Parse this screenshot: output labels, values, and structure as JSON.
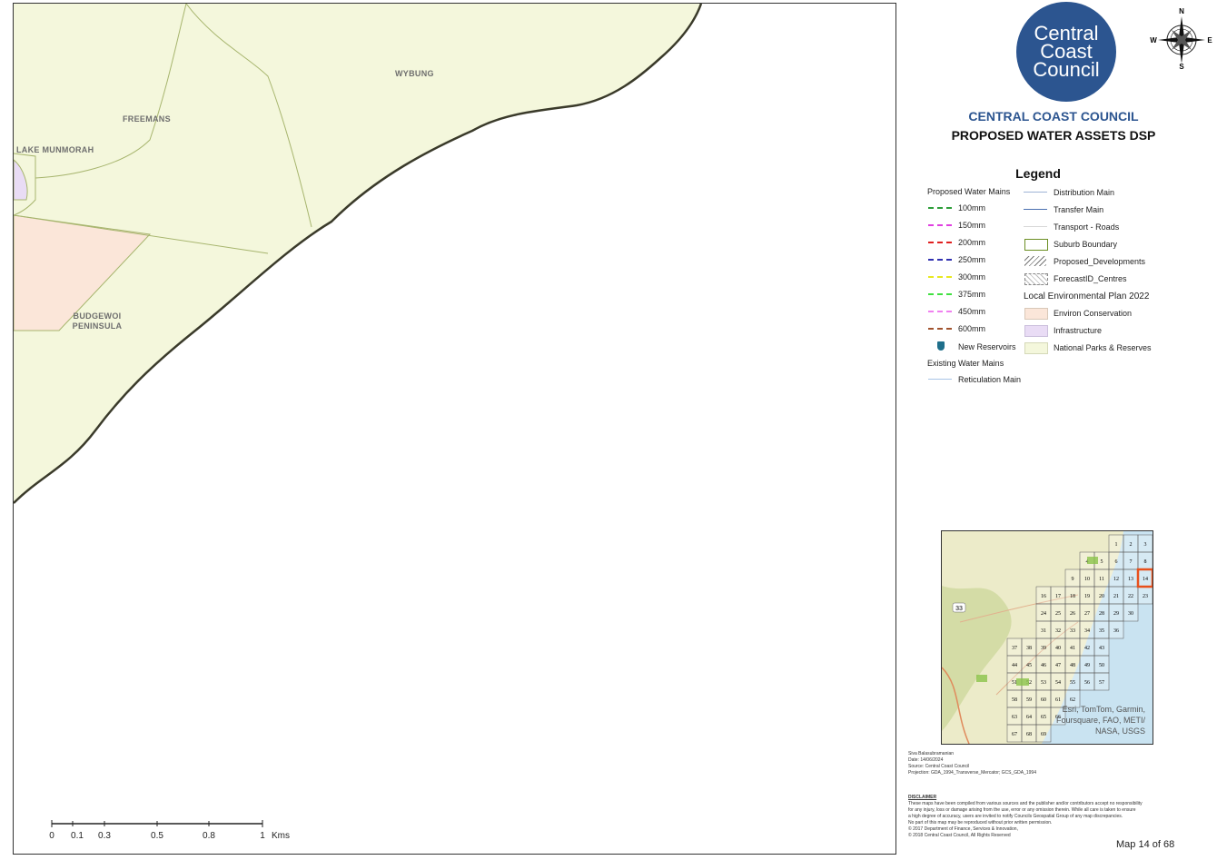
{
  "map": {
    "suburbs": [
      "WYBUNG",
      "FREEMANS",
      "LAKE MUNMORAH",
      "BUDGEWOI",
      "PENINSULA"
    ],
    "scale": {
      "ticks": [
        "0",
        "0.1",
        "0.3",
        "0.5",
        "0.8",
        "1"
      ],
      "unit": "Kms"
    }
  },
  "header": {
    "logo_line1": "Central",
    "logo_line2": "Coast",
    "logo_line3": "Council",
    "compass": {
      "n": "N",
      "s": "S",
      "e": "E",
      "w": "W"
    },
    "title": "CENTRAL COAST COUNCIL",
    "subtitle": "PROPOSED WATER ASSETS DSP"
  },
  "legend": {
    "title": "Legend",
    "proposed_heading": "Proposed Water Mains",
    "proposed_mains": [
      {
        "label": "100mm",
        "color": "#2e9e3a"
      },
      {
        "label": "150mm",
        "color": "#e040e0"
      },
      {
        "label": "200mm",
        "color": "#e02020"
      },
      {
        "label": "250mm",
        "color": "#3030b0"
      },
      {
        "label": "300mm",
        "color": "#e8e820"
      },
      {
        "label": "375mm",
        "color": "#40e040"
      },
      {
        "label": "450mm",
        "color": "#f080f0"
      },
      {
        "label": "600mm",
        "color": "#a0522d"
      }
    ],
    "new_reservoirs": "New Reservoirs",
    "existing_heading": "Existing Water Mains",
    "reticulation": "Reticulation Main",
    "right_items": {
      "distribution": "Distribution Main",
      "transfer": "Transfer Main",
      "roads": "Transport - Roads",
      "suburb": "Suburb Boundary",
      "proposed_dev": "Proposed_Developments",
      "forecast": "ForecastID_Centres",
      "lep_heading": "Local Environmental Plan 2022",
      "environ": "Environ Conservation",
      "infrastructure": "Infrastructure",
      "parks": "National Parks & Reserves"
    }
  },
  "overview": {
    "road_label": "33",
    "attribution_line1": "Esri, TomTom, Garmin,",
    "attribution_line2": "Foursquare, FAO, METI/",
    "attribution_line3": "NASA, USGS",
    "highlight": "14"
  },
  "metadata": {
    "author": "Siva Balasubramanian",
    "date": "Date: 14/06/2024",
    "source": "Source: Central Coast Council",
    "projection": "Projection: GDA_1994_Transverse_Mercator; GCS_GDA_1994"
  },
  "disclaimer": {
    "heading": "DISCLAIMER",
    "line1": "These maps have been compiled from various sources and the publisher and/or contributors accept no responsibility",
    "line2": "for any injury, loss or damage arising from the use, error or any omission therein. While all care is taken to ensure",
    "line3": "a high degree of accuracy, users are invited to notify Councils Geospatial Group of any map discrepancies.",
    "line4": "No part of this map may be reproduced without prior written permission.",
    "line5": "© 2017 Department of Finance, Services & Innovation,",
    "line6": "© 2018 Central Coast Council, All Rights Reserved"
  },
  "footer": {
    "map_number": "Map 14 of 68"
  }
}
